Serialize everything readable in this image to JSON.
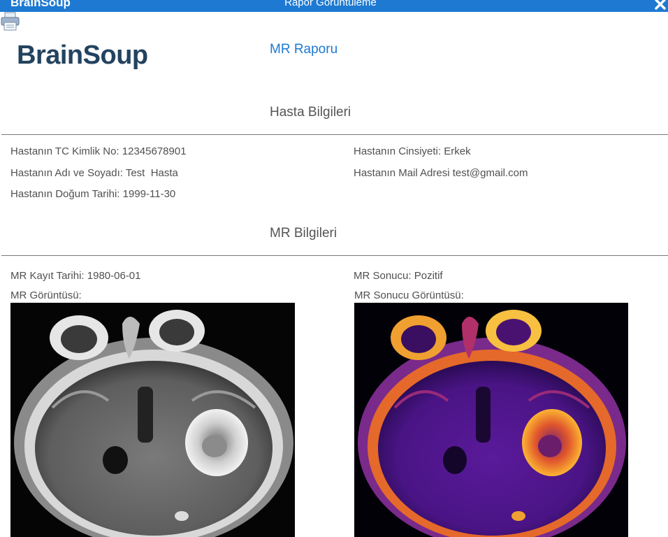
{
  "window": {
    "app_name": "BrainSoup",
    "title": "Rapor Görüntüleme"
  },
  "header": {
    "logo_text": "BrainSoup",
    "report_title": "MR Raporu"
  },
  "patient": {
    "section_title": "Hasta Bilgileri",
    "tc_label": "Hastanın TC Kimlik No:",
    "tc_value": "12345678901",
    "name_label": "Hastanın Adı ve Soyadı:",
    "name_value": "Test  Hasta",
    "birth_label": "Hastanın Doğum Tarihi:",
    "birth_value": "1999-11-30",
    "gender_label": "Hastanın Cinsiyeti:",
    "gender_value": "Erkek",
    "mail_label": "Hastanın Mail Adresi",
    "mail_value": "test@gmail.com"
  },
  "mr": {
    "section_title": "MR Bilgileri",
    "date_label": "MR Kayıt Tarihi:",
    "date_value": "1980-06-01",
    "image_label": "MR Görüntüsü:",
    "result_label": "MR Sonucu:",
    "result_value": "Pozitif",
    "result_image_label": "MR Sonucu Görüntüsü:"
  },
  "icons": {
    "print": "printer-icon",
    "close": "close-icon"
  },
  "colors": {
    "accent": "#1d79d2",
    "logo": "#23435f"
  }
}
